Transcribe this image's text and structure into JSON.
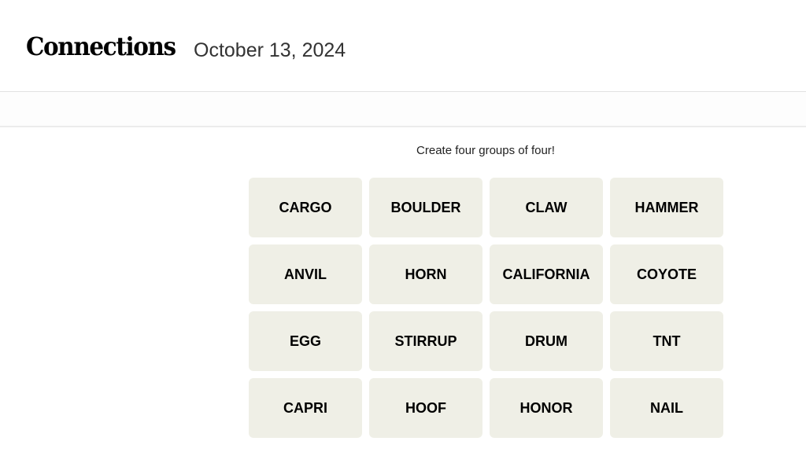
{
  "header": {
    "title": "Connections",
    "date": "October 13, 2024"
  },
  "game": {
    "instructions": "Create four groups of four!",
    "tiles": [
      "CARGO",
      "BOULDER",
      "CLAW",
      "HAMMER",
      "ANVIL",
      "HORN",
      "CALIFORNIA",
      "COYOTE",
      "EGG",
      "STIRRUP",
      "DRUM",
      "TNT",
      "CAPRI",
      "HOOF",
      "HONOR",
      "NAIL"
    ],
    "tile_color": "#efefe6"
  }
}
